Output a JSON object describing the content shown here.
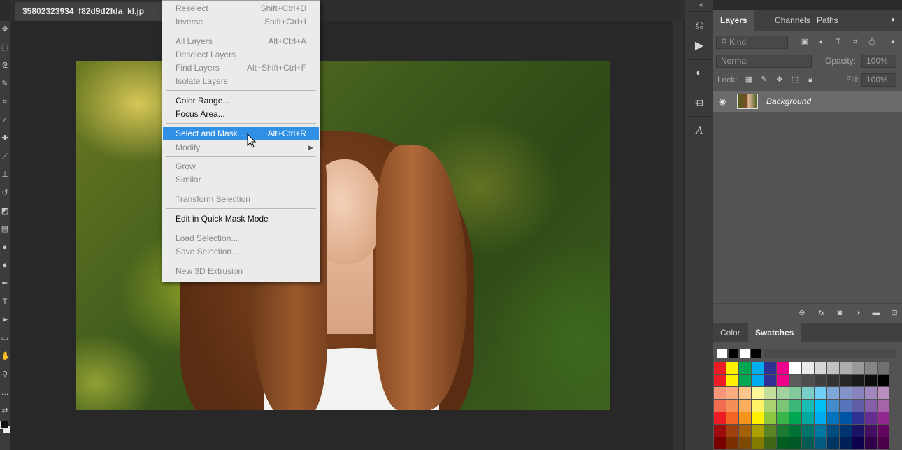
{
  "document": {
    "tab_title": "35802323934_f82d9d2fda_kl.jp"
  },
  "select_menu": {
    "items": [
      {
        "label": "Reselect",
        "shortcut": "Shift+Ctrl+D",
        "disabled": true
      },
      {
        "label": "Inverse",
        "shortcut": "Shift+Ctrl+I",
        "disabled": true
      },
      {
        "label": "All Layers",
        "shortcut": "Alt+Ctrl+A",
        "disabled": true
      },
      {
        "label": "Deselect Layers",
        "shortcut": "",
        "disabled": true
      },
      {
        "label": "Find Layers",
        "shortcut": "Alt+Shift+Ctrl+F",
        "disabled": true
      },
      {
        "label": "Isolate Layers",
        "shortcut": "",
        "disabled": true
      },
      {
        "label": "Color Range...",
        "shortcut": "",
        "disabled": false
      },
      {
        "label": "Focus Area...",
        "shortcut": "",
        "disabled": false
      },
      {
        "label": "Select and Mask...",
        "shortcut": "Alt+Ctrl+R",
        "highlighted": true
      },
      {
        "label": "Modify",
        "shortcut": "",
        "disabled": true,
        "submenu": true
      },
      {
        "label": "Grow",
        "shortcut": "",
        "disabled": true
      },
      {
        "label": "Similar",
        "shortcut": "",
        "disabled": true
      },
      {
        "label": "Transform Selection",
        "shortcut": "",
        "disabled": true
      },
      {
        "label": "Edit in Quick Mask Mode",
        "shortcut": "",
        "disabled": false
      },
      {
        "label": "Load Selection...",
        "shortcut": "",
        "disabled": true
      },
      {
        "label": "Save Selection...",
        "shortcut": "",
        "disabled": true
      },
      {
        "label": "New 3D Extrusion",
        "shortcut": "",
        "disabled": true
      }
    ]
  },
  "layers_panel": {
    "tabs": [
      "Layers",
      "Channels",
      "Paths"
    ],
    "active_tab": "Layers",
    "filter": {
      "kind_label": "Kind",
      "search_icon": "search-icon"
    },
    "blend_mode": "Normal",
    "opacity_label": "Opacity:",
    "opacity_value": "100%",
    "lock_label": "Lock:",
    "fill_label": "Fill:",
    "fill_value": "100%",
    "layers": [
      {
        "name": "Background",
        "visible": true
      }
    ]
  },
  "swatches_panel": {
    "tabs": [
      "Color",
      "Swatches"
    ],
    "active_tab": "Swatches",
    "recent": [
      "#ffffff",
      "#000000",
      "#ffffff",
      "#000000"
    ],
    "rows": [
      [
        "#ed1c24",
        "#fff200",
        "#00a651",
        "#00aeef",
        "#2e3192",
        "#ec008c",
        "#ffffff",
        "#ebebeb",
        "#d7d7d7",
        "#c2c2c2",
        "#adadad",
        "#999999",
        "#858585",
        "#707070"
      ],
      [
        "#ed1c24",
        "#fff200",
        "#00a651",
        "#00aeef",
        "#2e3192",
        "#ec008c",
        "#5c5c5c",
        "#4d4d4d",
        "#3f3f3f",
        "#333333",
        "#262626",
        "#1a1a1a",
        "#0d0d0d",
        "#000000"
      ],
      [
        "#f7977a",
        "#f9ad81",
        "#fdc68a",
        "#fff79a",
        "#c4df9b",
        "#a2d39c",
        "#82ca9d",
        "#7bcdc8",
        "#6ecff6",
        "#7ea7d8",
        "#8393ca",
        "#8882be",
        "#a187be",
        "#bc8dbf"
      ],
      [
        "#f26c4f",
        "#f68e55",
        "#fbaf5c",
        "#fff467",
        "#acd372",
        "#7cc576",
        "#3bb878",
        "#1abbb4",
        "#00bff3",
        "#438ccb",
        "#5574b9",
        "#605ca8",
        "#855fa8",
        "#a763a8"
      ],
      [
        "#ed1c24",
        "#f26522",
        "#f7941d",
        "#fff200",
        "#8dc73f",
        "#39b54a",
        "#00a651",
        "#00a99d",
        "#00aeef",
        "#0072bc",
        "#0054a6",
        "#2e3192",
        "#662d91",
        "#92278f"
      ],
      [
        "#9e0b0f",
        "#a0410d",
        "#a36209",
        "#aba000",
        "#598527",
        "#1a7b30",
        "#007236",
        "#00746b",
        "#0076a3",
        "#004b80",
        "#003471",
        "#1b1464",
        "#440e62",
        "#630460"
      ],
      [
        "#790000",
        "#7b2e00",
        "#7d4900",
        "#827b00",
        "#406618",
        "#005e20",
        "#005826",
        "#005952",
        "#005b7f",
        "#003663",
        "#002157",
        "#0d004c",
        "#32004b",
        "#4b0049"
      ]
    ]
  }
}
